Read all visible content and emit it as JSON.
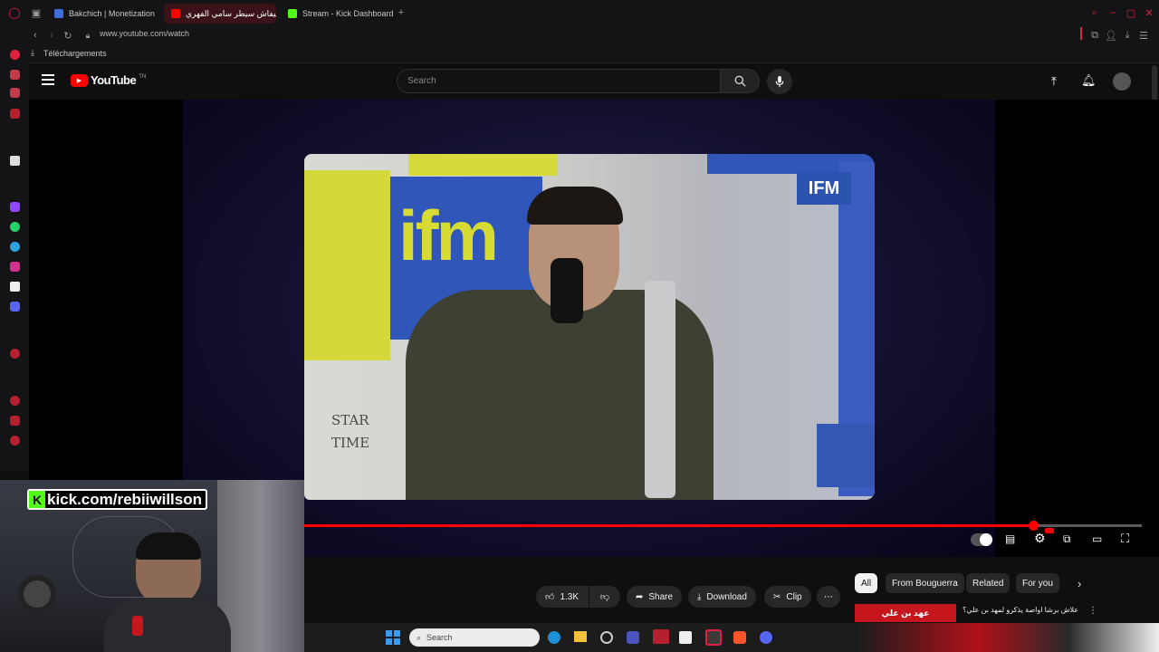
{
  "browser": {
    "tabs": [
      {
        "label": "Bakchich | Monetization"
      },
      {
        "label": "كيفاش سيطر سامي الفهري"
      },
      {
        "label": "Stream - Kick Dashboard"
      }
    ],
    "new_tab_icon": "plus-icon",
    "url": "www.youtube.com/watch",
    "bookmark": "Téléchargements"
  },
  "youtube": {
    "logo_text": "YouTube",
    "logo_suffix": "TN",
    "search_placeholder": "Search"
  },
  "player": {
    "progress": 0.87,
    "video_text": {
      "studio_logo": "ifm",
      "badge": "IFM",
      "show": "STAR TIME"
    }
  },
  "actions": {
    "likes": "1.3K",
    "share": "Share",
    "download": "Download",
    "clip": "Clip"
  },
  "chips": [
    "All",
    "From Bouguerra",
    "Related",
    "For you"
  ],
  "recommendation": {
    "title": "علاش برشا اواصة يذكرو لمهد بن علي؟",
    "thumb_text": "عهد بن علي"
  },
  "overlay": {
    "kick_url": "kick.com/rebiiwillson"
  },
  "taskbar": {
    "search": "Search"
  },
  "colors": {
    "accent": "#ff0000",
    "kick_green": "#53fc18",
    "opera_red": "#e0203c"
  }
}
